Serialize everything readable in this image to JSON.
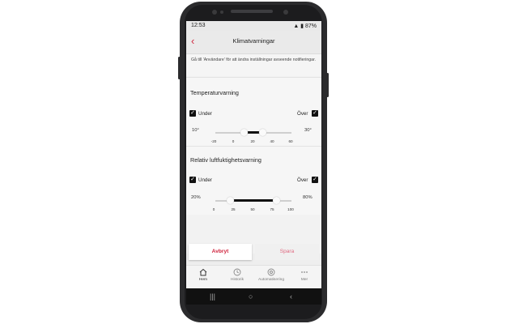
{
  "status_bar": {
    "time": "12:53",
    "battery": "87%"
  },
  "header": {
    "back_icon": "chevron-left-icon",
    "title": "Klimatvarningar"
  },
  "info_text": "Gå till 'Användare' för att ändra inställningar avseende notifieringar.",
  "temperature": {
    "title": "Temperaturvarning",
    "under_label": "Under",
    "over_label": "Över",
    "under_checked": true,
    "over_checked": true,
    "min_value": "10°",
    "max_value": "30°",
    "ticks": [
      "-20",
      "0",
      "20",
      "40",
      "60"
    ],
    "scale": [
      -20,
      60
    ],
    "range": [
      10,
      30
    ]
  },
  "humidity": {
    "title": "Relativ luftfuktighetsvarning",
    "under_label": "Under",
    "over_label": "Över",
    "under_checked": true,
    "over_checked": true,
    "min_value": "20%",
    "max_value": "80%",
    "ticks": [
      "0",
      "25",
      "50",
      "75",
      "100"
    ],
    "scale": [
      0,
      100
    ],
    "range": [
      20,
      80
    ]
  },
  "buttons": {
    "cancel": "Avbryt",
    "save": "Spara"
  },
  "tabs": [
    {
      "label": "Hem",
      "icon": "home-icon",
      "active": true
    },
    {
      "label": "Historik",
      "icon": "clock-icon",
      "active": false
    },
    {
      "label": "Automatisering",
      "icon": "automation-icon",
      "active": false
    },
    {
      "label": "Mer",
      "icon": "more-icon",
      "active": false
    }
  ],
  "colors": {
    "accent": "#d0263f"
  }
}
